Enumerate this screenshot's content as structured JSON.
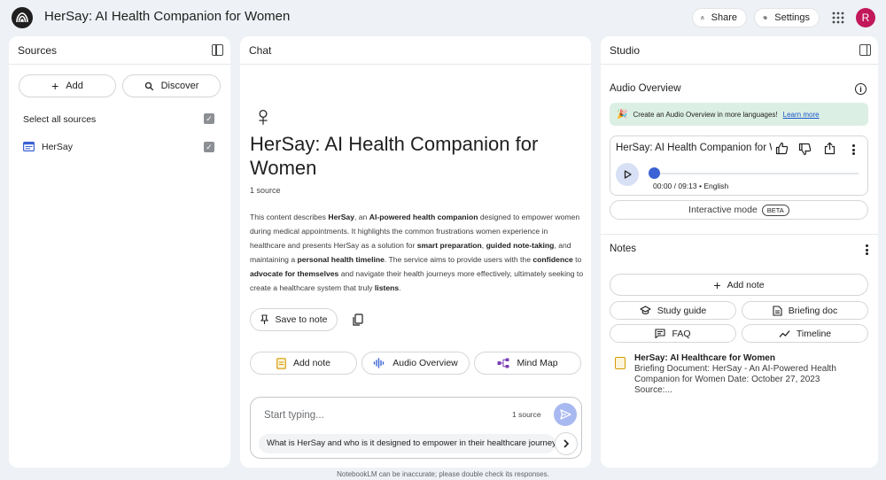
{
  "app": {
    "title": "HerSay: AI Health Companion for Women",
    "share_label": "Share",
    "settings_label": "Settings",
    "avatar_initial": "R",
    "avatar_color": "#c2185b"
  },
  "sources_panel": {
    "title": "Sources",
    "add_label": "Add",
    "discover_label": "Discover",
    "select_all_label": "Select all sources",
    "items": [
      {
        "name": "HerSay",
        "checked": true,
        "icon": "web-page-icon"
      }
    ]
  },
  "chat_panel": {
    "title": "Chat",
    "symbol": "♀",
    "notebook_title": "HerSay: AI Health Companion for Women",
    "source_count": "1 source",
    "summary": [
      {
        "text": "This content describes ",
        "bold": false
      },
      {
        "text": "HerSay",
        "bold": true
      },
      {
        "text": ", an ",
        "bold": false
      },
      {
        "text": "AI-powered health companion",
        "bold": true
      },
      {
        "text": " designed to empower women during medical appointments. It highlights the common frustrations women experience in healthcare and presents HerSay as a solution for ",
        "bold": false
      },
      {
        "text": "smart preparation",
        "bold": true
      },
      {
        "text": ", ",
        "bold": false
      },
      {
        "text": "guided note-taking",
        "bold": true
      },
      {
        "text": ", and maintaining a ",
        "bold": false
      },
      {
        "text": "personal health timeline",
        "bold": true
      },
      {
        "text": ". The service aims to provide users with the ",
        "bold": false
      },
      {
        "text": "confidence",
        "bold": true
      },
      {
        "text": " to ",
        "bold": false
      },
      {
        "text": "advocate for themselves",
        "bold": true
      },
      {
        "text": " and navigate their health journeys more effectively, ultimately seeking to create a healthcare system that truly ",
        "bold": false
      },
      {
        "text": "listens",
        "bold": true
      },
      {
        "text": ".",
        "bold": false
      }
    ],
    "save_to_note_label": "Save to note",
    "actions": {
      "add_note": "Add note",
      "audio_overview": "Audio Overview",
      "mind_map": "Mind Map"
    },
    "input_placeholder": "Start typing...",
    "input_value": "",
    "input_source_count": "1 source",
    "suggested_question": "What is HerSay and who is it designed to empower in their healthcare journey?",
    "footer_note": "NotebookLM can be inaccurate; please double check its responses."
  },
  "studio_panel": {
    "title": "Studio",
    "audio_overview_label": "Audio Overview",
    "banner_text": "Create an Audio Overview in more languages!",
    "banner_link": "Learn more",
    "player": {
      "title": "HerSay: AI Health Companion for Women",
      "time": "00:00 / 09:13 • English",
      "progress": 0
    },
    "interactive_mode_label": "Interactive mode",
    "beta_label": "BETA",
    "notes_label": "Notes",
    "add_note_label": "Add note",
    "note_buttons": {
      "study_guide": "Study guide",
      "briefing_doc": "Briefing doc",
      "faq": "FAQ",
      "timeline": "Timeline"
    },
    "notes": [
      {
        "title": "HerSay: AI Healthcare for Women",
        "preview": "Briefing Document: HerSay - An AI-Powered Health Companion for Women Date: October 27, 2023 Source:..."
      }
    ]
  },
  "colors": {
    "background": "#eef1f5",
    "accent": "#3b63d4",
    "banner": "#dcefe4",
    "send_button": "#a8b8f0"
  }
}
